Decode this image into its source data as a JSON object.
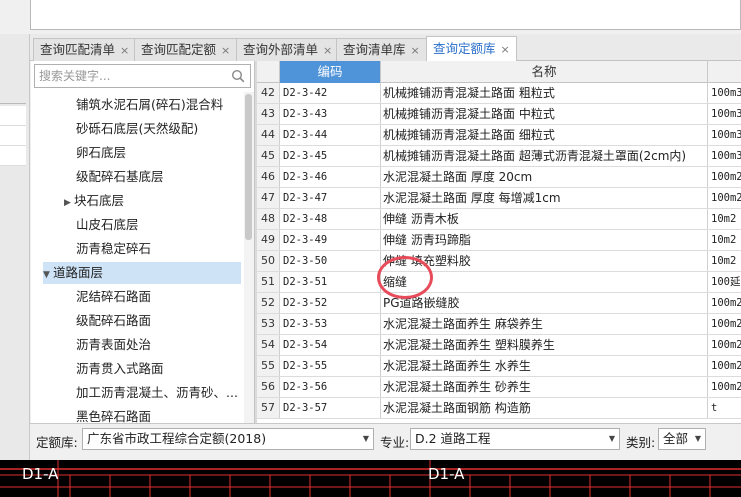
{
  "tabs": [
    {
      "label": "查询匹配清单"
    },
    {
      "label": "查询匹配定额"
    },
    {
      "label": "查询外部清单"
    },
    {
      "label": "查询清单库"
    },
    {
      "label": "查询定额库",
      "active": true
    }
  ],
  "tab_close_symbol": "×",
  "search": {
    "placeholder": "搜索关键字..."
  },
  "tree": [
    {
      "label": "铺筑水泥石屑(碎石)混合料",
      "level": 2
    },
    {
      "label": "砂砾石底层(天然级配)",
      "level": 2
    },
    {
      "label": "卵石底层",
      "level": 2
    },
    {
      "label": "级配碎石基底层",
      "level": 2
    },
    {
      "label": "块石底层",
      "level": 2,
      "has_children": true
    },
    {
      "label": "山皮石底层",
      "level": 2
    },
    {
      "label": "沥青稳定碎石",
      "level": 2
    },
    {
      "label": "道路面层",
      "level": 1,
      "expanded": true,
      "selected": true
    },
    {
      "label": "泥结碎石路面",
      "level": 2
    },
    {
      "label": "级配碎石路面",
      "level": 2
    },
    {
      "label": "沥青表面处治",
      "level": 2
    },
    {
      "label": "沥青贯入式路面",
      "level": 2
    },
    {
      "label": "加工沥青混凝土、沥青砂、...",
      "level": 2
    },
    {
      "label": "黑色碎石路面",
      "level": 2
    }
  ],
  "grid": {
    "headers": {
      "code": "编码",
      "name": "名称"
    },
    "rows": [
      {
        "idx": "42",
        "code": "D2-3-42",
        "name": "机械摊铺沥青混凝土路面 粗粒式",
        "unit": "100m3"
      },
      {
        "idx": "43",
        "code": "D2-3-43",
        "name": "机械摊铺沥青混凝土路面 中粒式",
        "unit": "100m3"
      },
      {
        "idx": "44",
        "code": "D2-3-44",
        "name": "机械摊铺沥青混凝土路面 细粒式",
        "unit": "100m3"
      },
      {
        "idx": "45",
        "code": "D2-3-45",
        "name": "机械摊铺沥青混凝土路面 超薄式沥青混凝土罩面(2cm内)",
        "unit": "100m3"
      },
      {
        "idx": "46",
        "code": "D2-3-46",
        "name": "水泥混凝土路面 厚度 20cm",
        "unit": "100m2"
      },
      {
        "idx": "47",
        "code": "D2-3-47",
        "name": "水泥混凝土路面 厚度 每增减1cm",
        "unit": "100m2"
      },
      {
        "idx": "48",
        "code": "D2-3-48",
        "name": "伸缝 沥青木板",
        "unit": "10m2"
      },
      {
        "idx": "49",
        "code": "D2-3-49",
        "name": "伸缝 沥青玛蹄脂",
        "unit": "10m2"
      },
      {
        "idx": "50",
        "code": "D2-3-50",
        "name": "伸缝 填充塑料胶",
        "unit": "10m2"
      },
      {
        "idx": "51",
        "code": "D2-3-51",
        "name": "缩缝",
        "unit": "100延"
      },
      {
        "idx": "52",
        "code": "D2-3-52",
        "name": "PG道路嵌缝胶",
        "unit": "100m2"
      },
      {
        "idx": "53",
        "code": "D2-3-53",
        "name": "水泥混凝土路面养生 麻袋养生",
        "unit": "100m2"
      },
      {
        "idx": "54",
        "code": "D2-3-54",
        "name": "水泥混凝土路面养生 塑料膜养生",
        "unit": "100m2"
      },
      {
        "idx": "55",
        "code": "D2-3-55",
        "name": "水泥混凝土路面养生 水养生",
        "unit": "100m2"
      },
      {
        "idx": "56",
        "code": "D2-3-56",
        "name": "水泥混凝土路面养生 砂养生",
        "unit": "100m2"
      },
      {
        "idx": "57",
        "code": "D2-3-57",
        "name": "水泥混凝土路面钢筋 构造筋",
        "unit": "t"
      }
    ]
  },
  "bottom": {
    "quota_label": "定额库:",
    "quota_value": "广东省市政工程综合定额(2018)",
    "major_label": "专业:",
    "major_value": "D.2 道路工程",
    "category_label": "类别:",
    "category_value": "全部"
  },
  "cad": {
    "label_left": "D1-A",
    "label_right": "D1-A",
    "line_color": "#e03030"
  },
  "colors": {
    "accent": "#4f93d8",
    "active_tab_text": "#2a6fc9",
    "highlight_circle": "#e84c5a",
    "tree_selected": "#cfe3f7"
  }
}
